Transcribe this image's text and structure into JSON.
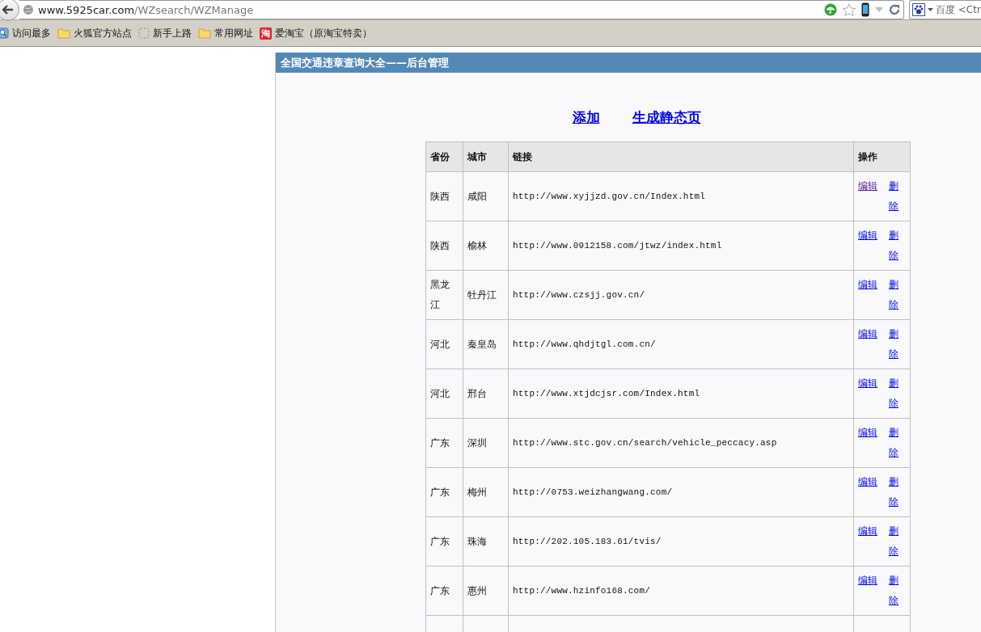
{
  "browser": {
    "url_host": "www.5925car.com",
    "url_path": "/WZsearch/WZManage",
    "search_engine": "百度 <Ctr"
  },
  "bookmarks": [
    {
      "kind": "search",
      "label": "访问最多"
    },
    {
      "kind": "folder",
      "label": "火狐官方站点"
    },
    {
      "kind": "page",
      "label": "新手上路"
    },
    {
      "kind": "folder",
      "label": "常用网址"
    },
    {
      "kind": "badge",
      "icon_text": "淘",
      "label": "爱淘宝（原淘宝特卖）"
    }
  ],
  "panel": {
    "title": "全国交通违章查询大全——后台管理"
  },
  "actions": [
    "添加",
    "生成静态页"
  ],
  "table": {
    "columns": [
      "省份",
      "城市",
      "链接",
      "操作"
    ],
    "rows": [
      {
        "province": "陕西",
        "city": "咸阳",
        "link": "http://www.xyjjzd.gov.cn/Index.html",
        "edit": "编辑",
        "delete": "删除",
        "edit_visited": true
      },
      {
        "province": "陕西",
        "city": "榆林",
        "link": "http://www.0912158.com/jtwz/index.html",
        "edit": "编辑",
        "delete": "删除",
        "edit_visited": false
      },
      {
        "province": "黑龙江",
        "city": "牡丹江",
        "link": "http://www.czsjj.gov.cn/",
        "edit": "编辑",
        "delete": "删除",
        "edit_visited": false
      },
      {
        "province": "河北",
        "city": "秦皇岛",
        "link": "http://www.qhdjtgl.com.cn/",
        "edit": "编辑",
        "delete": "删除",
        "edit_visited": false
      },
      {
        "province": "河北",
        "city": "邢台",
        "link": "http://www.xtjdcjsr.com/Index.html",
        "edit": "编辑",
        "delete": "删除",
        "edit_visited": false
      },
      {
        "province": "广东",
        "city": "深圳",
        "link": "http://www.stc.gov.cn/search/vehicle_peccacy.asp",
        "edit": "编辑",
        "delete": "删除",
        "edit_visited": false
      },
      {
        "province": "广东",
        "city": "梅州",
        "link": "http://0753.weizhangwang.com/",
        "edit": "编辑",
        "delete": "删除",
        "edit_visited": false
      },
      {
        "province": "广东",
        "city": "珠海",
        "link": "http://202.105.183.61/tvis/",
        "edit": "编辑",
        "delete": "删除",
        "edit_visited": false
      },
      {
        "province": "广东",
        "city": "惠州",
        "link": "http://www.hzinfo168.com/",
        "edit": "编辑",
        "delete": "删除",
        "edit_visited": false
      }
    ]
  }
}
